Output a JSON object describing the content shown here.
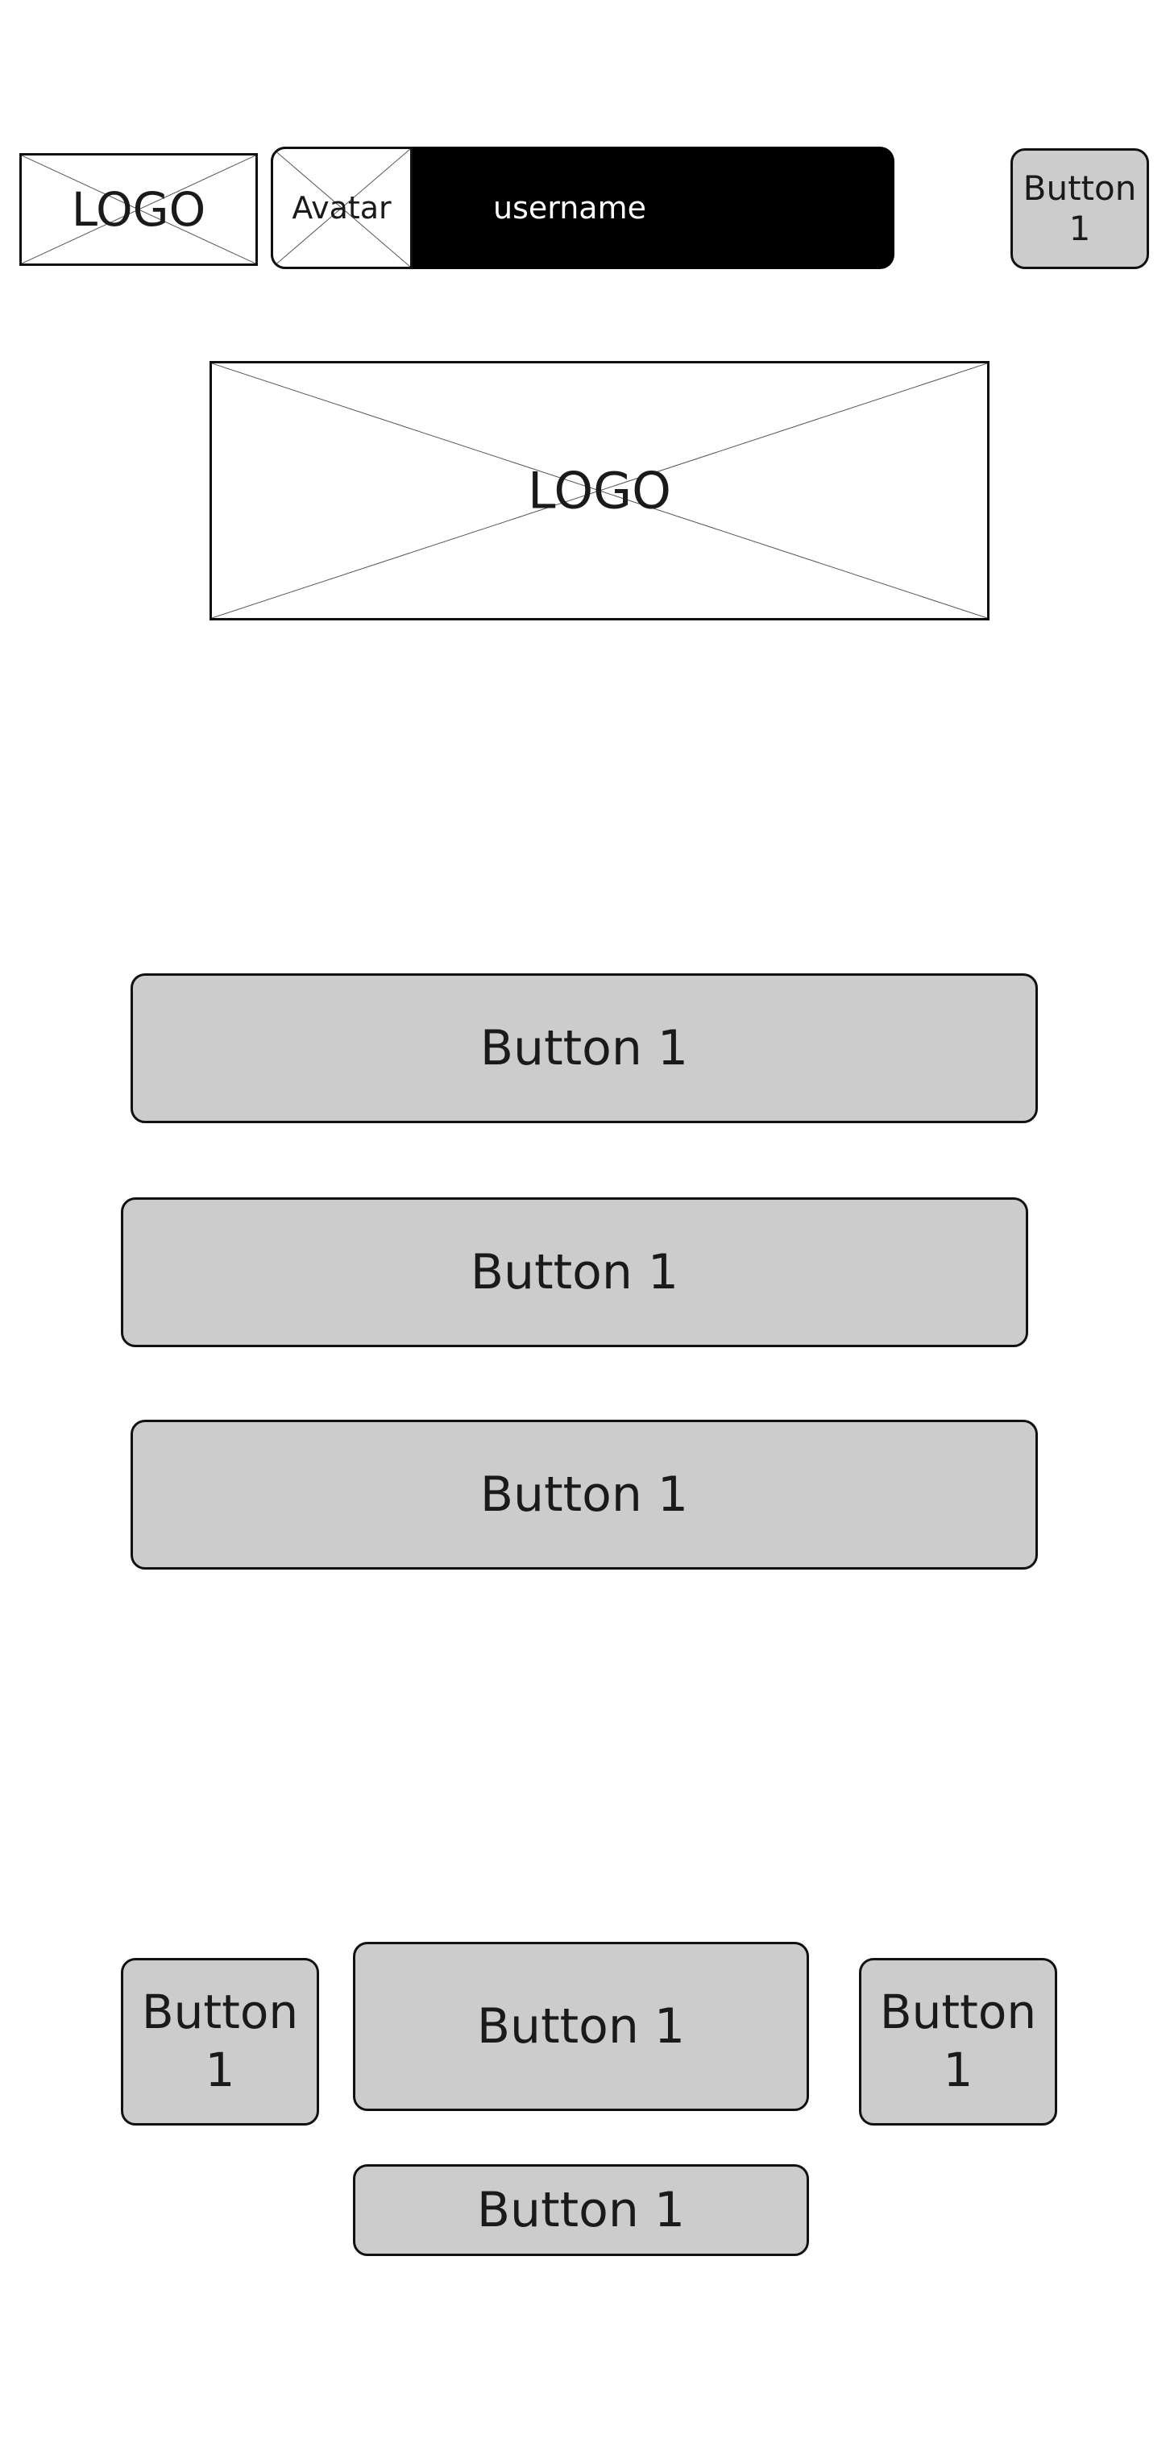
{
  "header": {
    "logo_label": "LOGO",
    "avatar_label": "Avatar",
    "username": "username",
    "button_label": "Button\n1"
  },
  "hero": {
    "logo_label": "LOGO"
  },
  "menu": {
    "buttons": [
      {
        "label": "Button 1"
      },
      {
        "label": "Button 1"
      },
      {
        "label": "Button 1"
      }
    ]
  },
  "bottom_controls": {
    "left_button": "Button\n1",
    "center_button": "Button 1",
    "right_button": "Button\n1",
    "lower_button": "Button 1"
  },
  "colors": {
    "button_fill": "#cccccc",
    "user_bar": "#000000",
    "outline": "#111111"
  }
}
